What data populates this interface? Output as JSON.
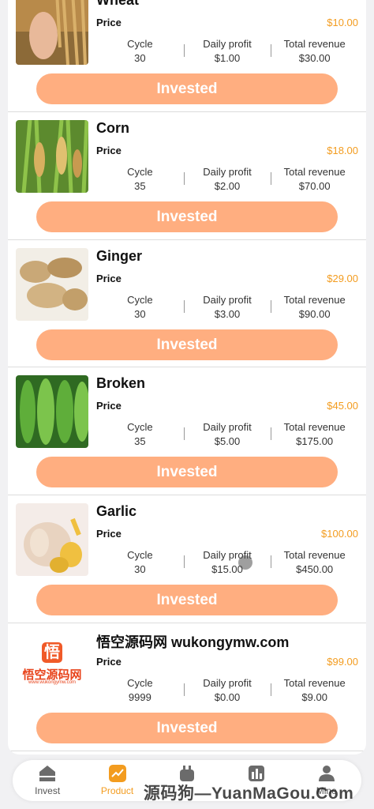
{
  "products": [
    {
      "name": "Wheat",
      "price_label": "Price",
      "price": "$10.00",
      "cycle_label": "Cycle",
      "cycle": "30",
      "daily_label": "Daily profit",
      "daily": "$1.00",
      "total_label": "Total revenue",
      "total": "$30.00",
      "button": "Invested",
      "image": "wheat"
    },
    {
      "name": "Corn",
      "price_label": "Price",
      "price": "$18.00",
      "cycle_label": "Cycle",
      "cycle": "35",
      "daily_label": "Daily profit",
      "daily": "$2.00",
      "total_label": "Total revenue",
      "total": "$70.00",
      "button": "Invested",
      "image": "corn"
    },
    {
      "name": "Ginger",
      "price_label": "Price",
      "price": "$29.00",
      "cycle_label": "Cycle",
      "cycle": "30",
      "daily_label": "Daily profit",
      "daily": "$3.00",
      "total_label": "Total revenue",
      "total": "$90.00",
      "button": "Invested",
      "image": "ginger"
    },
    {
      "name": "Broken",
      "price_label": "Price",
      "price": "$45.00",
      "cycle_label": "Cycle",
      "cycle": "35",
      "daily_label": "Daily profit",
      "daily": "$5.00",
      "total_label": "Total revenue",
      "total": "$175.00",
      "button": "Invested",
      "image": "bitter-melon"
    },
    {
      "name": "Garlic",
      "price_label": "Price",
      "price": "$100.00",
      "cycle_label": "Cycle",
      "cycle": "30",
      "daily_label": "Daily profit",
      "daily": "$15.00",
      "total_label": "Total revenue",
      "total": "$450.00",
      "button": "Invested",
      "image": "garlic"
    },
    {
      "name": "悟空源码网 wukongymw.com",
      "price_label": "Price",
      "price": "$99.00",
      "cycle_label": "Cycle",
      "cycle": "9999",
      "daily_label": "Daily profit",
      "daily": "$0.00",
      "total_label": "Total revenue",
      "total": "$9.00",
      "button": "Invested",
      "image": "logo",
      "logo_char": "悟",
      "logo_text": "悟空源码网",
      "logo_sub": "www.wukongymw.com"
    }
  ],
  "tabs": [
    {
      "label": "Invest",
      "icon": "home-icon",
      "active": false
    },
    {
      "label": "Product",
      "icon": "chart-icon",
      "active": true
    },
    {
      "label": "",
      "icon": "plug-icon",
      "active": false
    },
    {
      "label": "",
      "icon": "bar-chart-icon",
      "active": false
    },
    {
      "label": "Mine",
      "icon": "user-icon",
      "active": false
    }
  ],
  "watermark": "源码狗—YuanMaGou.Com",
  "colors": {
    "accent": "#f39c1f",
    "button": "#ffae80",
    "background": "#f1f1f3"
  }
}
